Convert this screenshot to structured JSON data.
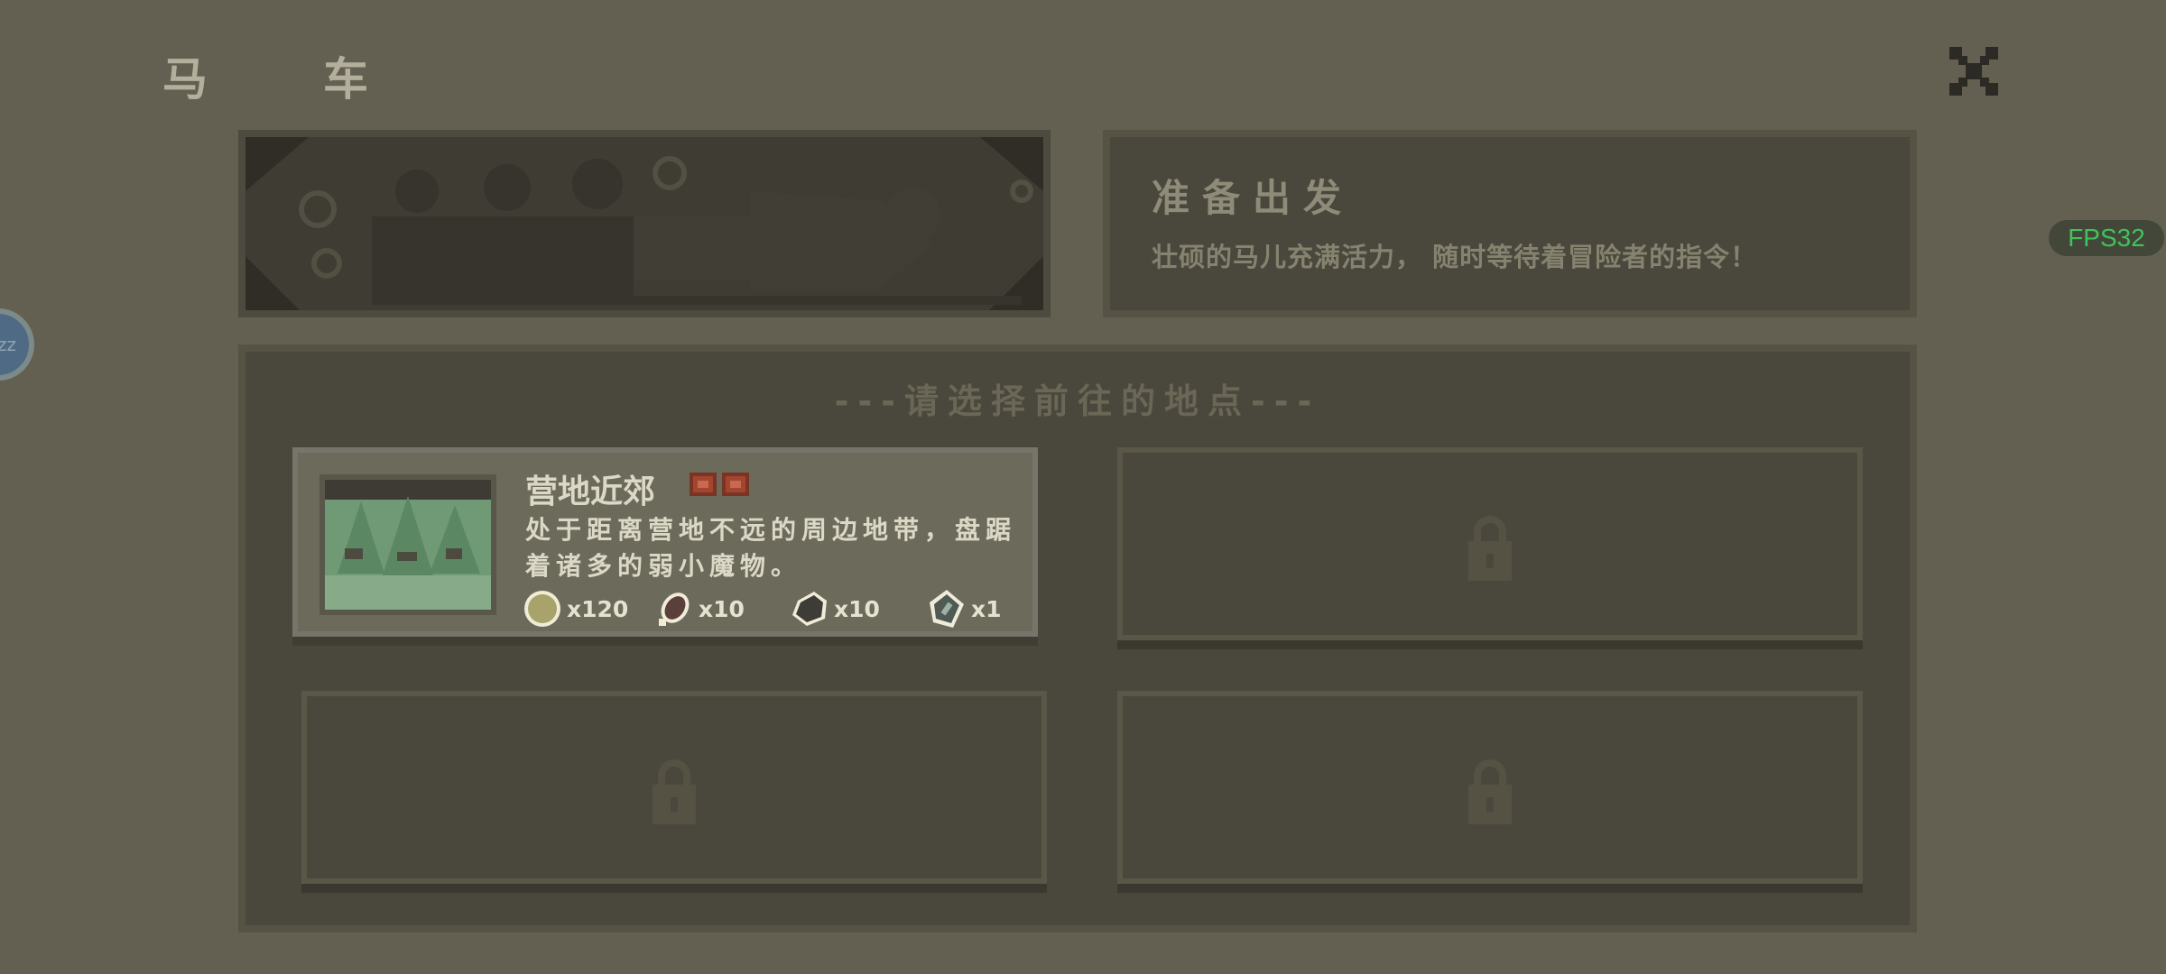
{
  "header": {
    "title_chars": [
      "马",
      "车"
    ],
    "close_icon": "close-x-icon"
  },
  "overlay": {
    "fps_label": "FPS32",
    "sleep_button_label": "zz"
  },
  "info": {
    "title": "准备出发",
    "subtitle": "壮硕的马儿充满活力， 随时等待着冒险者的指令！"
  },
  "destinations": {
    "heading": "---请选择前往的地点---",
    "items": [
      {
        "name": "营地近郊",
        "description": "处于距离营地不远的周边地带，盘踞着诸多的弱小魔物。",
        "rewards": [
          {
            "icon": "gold-coin-icon",
            "amount": "x120"
          },
          {
            "icon": "meat-icon",
            "amount": "x10"
          },
          {
            "icon": "stone-icon",
            "amount": "x10"
          },
          {
            "icon": "gem-icon",
            "amount": "x1"
          }
        ],
        "locked": false
      },
      {
        "locked": true,
        "icon": "lock-icon"
      },
      {
        "locked": true,
        "icon": "lock-icon"
      },
      {
        "locked": true,
        "icon": "lock-icon"
      }
    ]
  },
  "colors": {
    "background": "#636052",
    "panel": "#4a473d",
    "active_card": "#6c6a5b",
    "fps_text": "#42c25a"
  }
}
